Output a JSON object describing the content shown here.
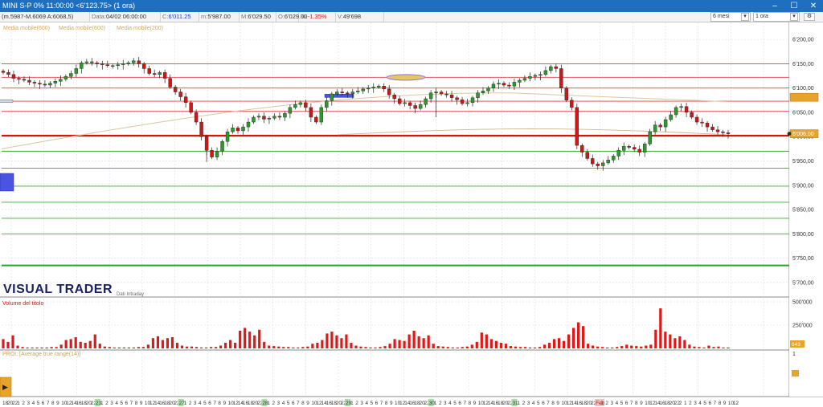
{
  "window": {
    "title": "MINI S-P 0%  11:00:00   <6'123.75>  (1 ora)",
    "minimize": "–",
    "maximize": "☐",
    "close": "✕"
  },
  "infobar": {
    "ohlc": "(m.5987-M.6069 A:6068,5)",
    "date_label": "Data:",
    "date_value": "04/02 06:00:00",
    "close_label": "C:",
    "close_value": "6'011.25",
    "min_label": "m:",
    "min_value": "5'987.00",
    "max_label": "M:",
    "max_value": "6'029.50",
    "open_label": "O:",
    "open_value": "6'029.00",
    "pct_label": "%:",
    "pct_value": "-1.35%",
    "vol_label": "V:",
    "vol_value": "49'698",
    "period_select": "6 mesi",
    "interval_select": "1 ora"
  },
  "legend": {
    "ma1": "Media mobile(600)",
    "ma2": "Media mobile(600)",
    "ma3": "Media mobile(200)"
  },
  "brand": {
    "name": "VISUAL TRADER",
    "sub": "Dati Intraday"
  },
  "volume_panel": {
    "title": "Volume del titolo",
    "last_value": "643"
  },
  "atr_panel": {
    "title": "PROI: [Average true range(14)]",
    "axis_top": "1"
  },
  "price_badge": "6'006.00",
  "colors": {
    "titlebar": "#1f6fc1",
    "up": "#2a9a2a",
    "down": "#d11515",
    "resistance": "#e04040",
    "support": "#3aa83a",
    "ma": "#d8c8a0"
  },
  "chart_data": {
    "type": "candlestick",
    "ylim": [
      5670,
      6225
    ],
    "y_ticks": [
      "6'200,00",
      "6'150,00",
      "6'100,00",
      "6'050,00",
      "6'000,00",
      "5'950,00",
      "5'900,00",
      "5'850,00",
      "5'800,00",
      "5'750,00",
      "5'700,00"
    ],
    "y_tick_values": [
      6200,
      6150,
      6100,
      6050,
      6000,
      5950,
      5900,
      5850,
      5800,
      5750,
      5700
    ],
    "resistance_lines": [
      6150,
      6122,
      6100,
      6073,
      6052
    ],
    "support_lines": [
      5970,
      5935,
      5898,
      5865,
      5832,
      5800
    ],
    "main_line": 6002,
    "bottom_line": 5735,
    "last_price": 6006,
    "close_path": [
      6132,
      6128,
      6120,
      6118,
      6116,
      6112,
      6110,
      6108,
      6106,
      6110,
      6114,
      6118,
      6124,
      6130,
      6140,
      6152,
      6154,
      6152,
      6150,
      6148,
      6146,
      6146,
      6148,
      6150,
      6152,
      6156,
      6150,
      6140,
      6130,
      6128,
      6132,
      6120,
      6102,
      6092,
      6082,
      6070,
      6050,
      6030,
      6000,
      5972,
      5958,
      5970,
      5990,
      6010,
      6018,
      6012,
      6020,
      6030,
      6040,
      6042,
      6036,
      6038,
      6042,
      6040,
      6048,
      6060,
      6066,
      6070,
      6060,
      6040,
      6030,
      6060,
      6074,
      6088,
      6092,
      6090,
      6088,
      6092,
      6094,
      6098,
      6100,
      6102,
      6104,
      6098,
      6086,
      6078,
      6068,
      6070,
      6064,
      6058,
      6066,
      6078,
      6090,
      6092,
      6088,
      6086,
      6080,
      6076,
      6068,
      6070,
      6080,
      6090,
      6094,
      6100,
      6108,
      6110,
      6106,
      6104,
      6112,
      6116,
      6120,
      6124,
      6126,
      6128,
      6136,
      6144,
      6140,
      6100,
      6075,
      6060,
      5982,
      5968,
      5955,
      5944,
      5940,
      5946,
      5952,
      5960,
      5972,
      5980,
      5978,
      5974,
      5968,
      5985,
      6010,
      6024,
      6020,
      6035,
      6045,
      6060,
      6062,
      6050,
      6040,
      6030,
      6028,
      6020,
      6014,
      6010,
      6008,
      6006
    ],
    "volume_bars": [
      0.2,
      0.14,
      0.28,
      0.06,
      0.03,
      0.02,
      0.02,
      0.02,
      0.02,
      0.02,
      0.03,
      0.03,
      0.08,
      0.18,
      0.2,
      0.24,
      0.14,
      0.12,
      0.16,
      0.3,
      0.1,
      0.04,
      0.03,
      0.02,
      0.02,
      0.02,
      0.02,
      0.02,
      0.03,
      0.03,
      0.08,
      0.22,
      0.26,
      0.18,
      0.22,
      0.24,
      0.12,
      0.06,
      0.04,
      0.04,
      0.03,
      0.02,
      0.02,
      0.03,
      0.03,
      0.06,
      0.12,
      0.18,
      0.12,
      0.38,
      0.44,
      0.36,
      0.28,
      0.4,
      0.14,
      0.06,
      0.05,
      0.04,
      0.03,
      0.03,
      0.02,
      0.02,
      0.03,
      0.04,
      0.1,
      0.12,
      0.18,
      0.32,
      0.36,
      0.28,
      0.22,
      0.3,
      0.12,
      0.06,
      0.04,
      0.03,
      0.02,
      0.02,
      0.03,
      0.05,
      0.1,
      0.2,
      0.18,
      0.16,
      0.3,
      0.38,
      0.26,
      0.22,
      0.28,
      0.1,
      0.05,
      0.04,
      0.03,
      0.02,
      0.02,
      0.03,
      0.04,
      0.08,
      0.14,
      0.34,
      0.3,
      0.2,
      0.16,
      0.12,
      0.1,
      0.05,
      0.04,
      0.03,
      0.03,
      0.02,
      0.02,
      0.03,
      0.08,
      0.12,
      0.2,
      0.22,
      0.16,
      0.3,
      0.44,
      0.56,
      0.48,
      0.1,
      0.06,
      0.04,
      0.03,
      0.02,
      0.02,
      0.03,
      0.05,
      0.08,
      0.06,
      0.05,
      0.04,
      0.06,
      0.08,
      0.4,
      0.86,
      0.36,
      0.3,
      0.22,
      0.26,
      0.18,
      0.08,
      0.04,
      0.03,
      0.02,
      0.06,
      0.03,
      0.04,
      0.02,
      0.02
    ],
    "volume_ylim": [
      0,
      500000
    ],
    "volume_ticks": [
      "500'000",
      "250'000"
    ],
    "volume_tick_values": [
      500000,
      250000
    ],
    "x_tick_labels": [
      "18",
      "20",
      "22",
      "1",
      "2",
      "3",
      "4",
      "5",
      "6",
      "7",
      "8",
      "9",
      "10",
      "12",
      "14",
      "16",
      "18",
      "20",
      "22",
      "23",
      "1",
      "2",
      "3",
      "4",
      "5",
      "6",
      "7",
      "8",
      "9",
      "10",
      "12",
      "14",
      "16",
      "18",
      "20",
      "22",
      "27",
      "1",
      "2",
      "3",
      "4",
      "5",
      "6",
      "7",
      "8",
      "9",
      "10",
      "12",
      "14",
      "16",
      "18",
      "20",
      "22",
      "28",
      "1",
      "2",
      "3",
      "4",
      "5",
      "6",
      "7",
      "8",
      "9",
      "10",
      "12",
      "14",
      "16",
      "18",
      "20",
      "22",
      "29",
      "1",
      "2",
      "3",
      "4",
      "5",
      "6",
      "7",
      "8",
      "9",
      "10",
      "12",
      "14",
      "16",
      "18",
      "20",
      "22",
      "30",
      "1",
      "2",
      "3",
      "4",
      "5",
      "6",
      "7",
      "8",
      "9",
      "10",
      "12",
      "14",
      "16",
      "18",
      "20",
      "22",
      "31",
      "1",
      "2",
      "3",
      "4",
      "5",
      "6",
      "7",
      "8",
      "9",
      "10",
      "12",
      "14",
      "16",
      "18",
      "20",
      "22",
      "Feb",
      "1",
      "2",
      "3",
      "4",
      "5",
      "6",
      "7",
      "8",
      "9",
      "10",
      "12",
      "14",
      "16",
      "18",
      "20",
      "22",
      "2",
      "1",
      "2",
      "3",
      "4",
      "5",
      "6",
      "7",
      "8",
      "9",
      "10",
      "12"
    ],
    "highlighted_x_labels": [
      "23",
      "27",
      "28",
      "29",
      "30",
      "31",
      "Feb",
      "2"
    ]
  }
}
